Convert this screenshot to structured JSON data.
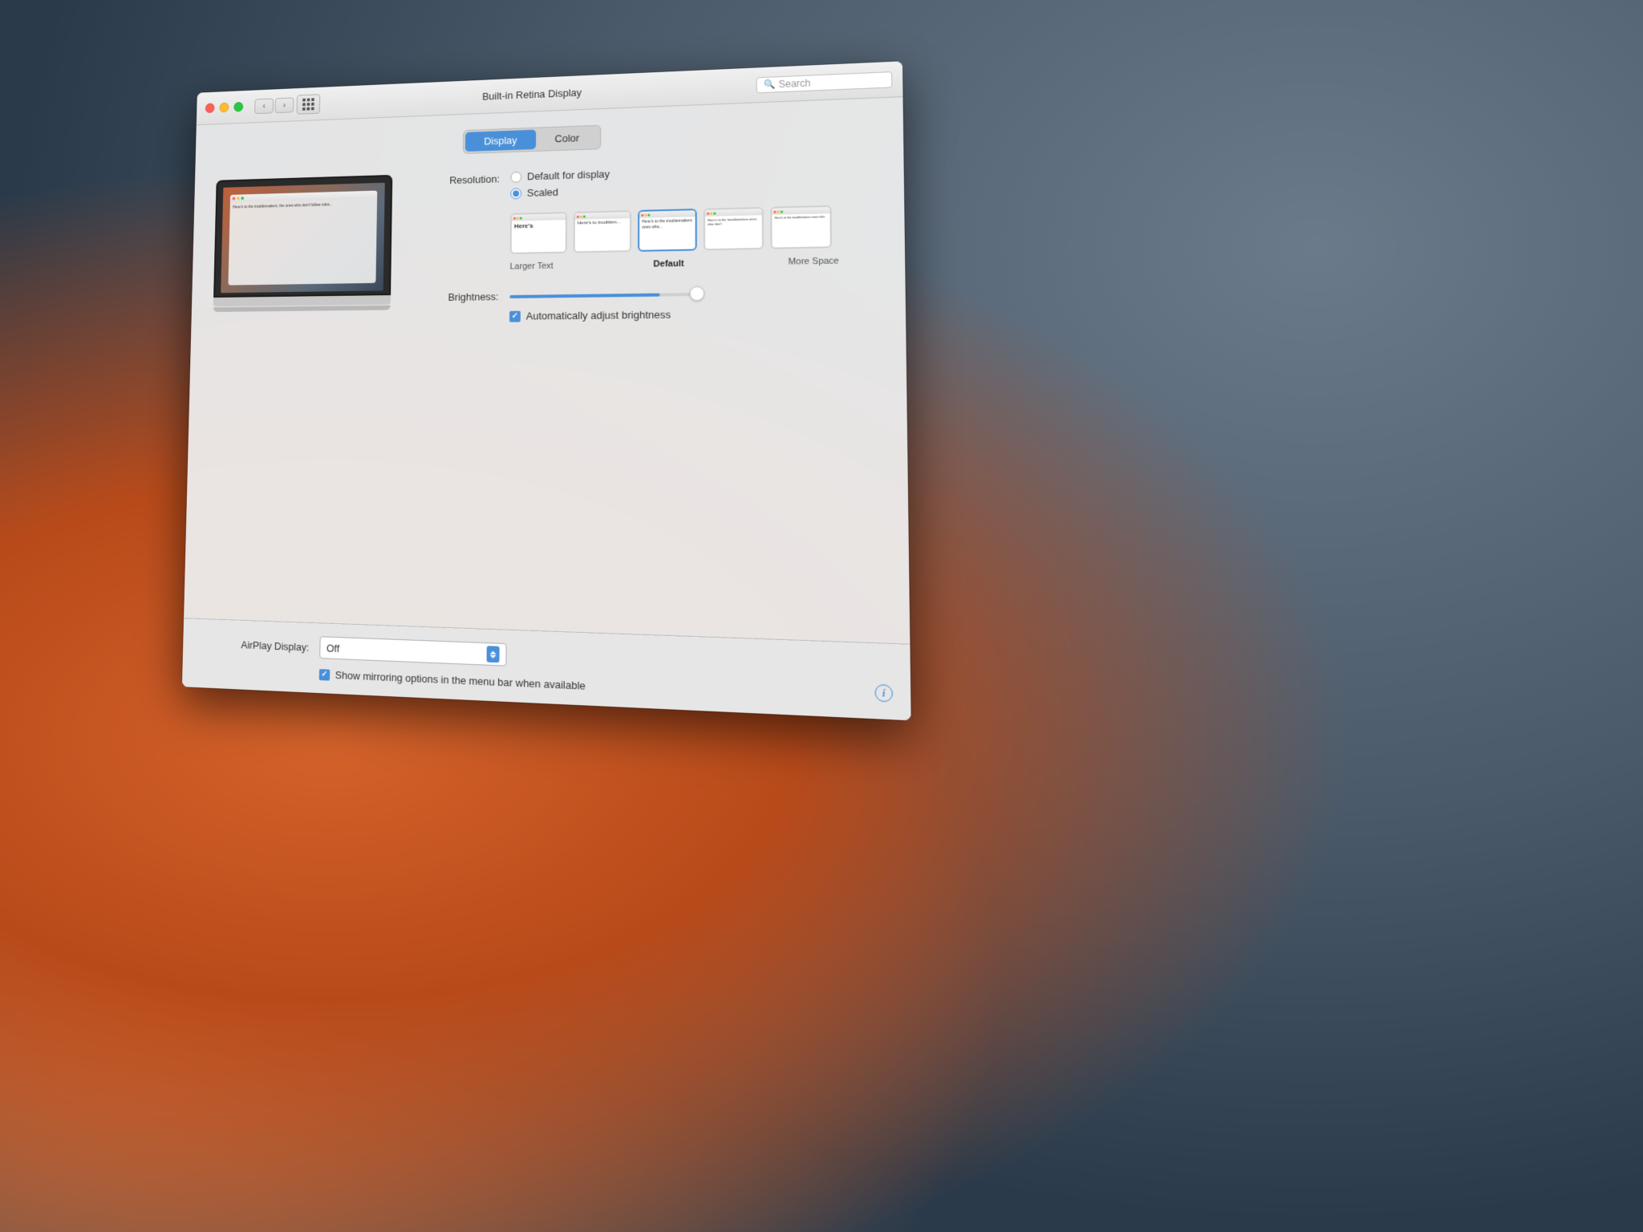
{
  "desktop": {
    "background": "macOS Yosemite El Capitan wallpaper"
  },
  "window": {
    "title": "Built-in Retina Display",
    "traffic_lights": {
      "close": "close",
      "minimize": "minimize",
      "maximize": "maximize"
    },
    "search_placeholder": "Search"
  },
  "tabs": [
    {
      "id": "display",
      "label": "Display",
      "active": true
    },
    {
      "id": "color",
      "label": "Color",
      "active": false
    }
  ],
  "resolution": {
    "label": "Resolution:",
    "options": [
      {
        "id": "default",
        "label": "Default for display",
        "selected": false
      },
      {
        "id": "scaled",
        "label": "Scaled",
        "selected": true
      }
    ]
  },
  "scale_options": [
    {
      "id": "larger",
      "label": "Larger Text",
      "selected": false,
      "content": "Here's"
    },
    {
      "id": "medium1",
      "label": "",
      "selected": false,
      "content": "Here's to troublem"
    },
    {
      "id": "default_scale",
      "label": "Default",
      "selected": true,
      "content": "Here's to troublemakers ones who"
    },
    {
      "id": "medium2",
      "label": "",
      "selected": false,
      "content": "Here's to the troublemakers ones who don't"
    },
    {
      "id": "more_space",
      "label": "More Space",
      "selected": false,
      "content": "Here's to the troublemakers ones who"
    }
  ],
  "brightness": {
    "label": "Brightness:",
    "value": 78,
    "auto_adjust": {
      "label": "Automatically adjust brightness",
      "checked": true
    }
  },
  "airplay": {
    "label": "AirPlay Display:",
    "value": "Off"
  },
  "mirroring": {
    "label": "Show mirroring options in the menu bar when available",
    "checked": true
  }
}
